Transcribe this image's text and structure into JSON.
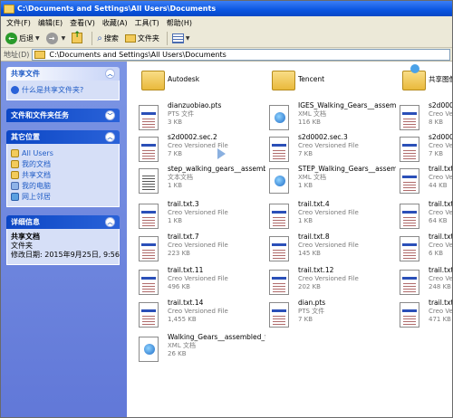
{
  "window": {
    "title": "C:\\Documents and Settings\\All Users\\Documents"
  },
  "menu": [
    "文件(F)",
    "编辑(E)",
    "查看(V)",
    "收藏(A)",
    "工具(T)",
    "帮助(H)"
  ],
  "toolbar": {
    "back_label": "后退",
    "search_label": "搜索",
    "folders_label": "文件夹"
  },
  "address": {
    "label": "地址(D)",
    "path": "C:\\Documents and Settings\\All Users\\Documents"
  },
  "tasks": {
    "shared_files": {
      "title": "共享文件",
      "items": [
        "什么是共享文件夹?"
      ]
    },
    "file_tasks": {
      "title": "文件和文件夹任务"
    },
    "other_places": {
      "title": "其它位置",
      "items": [
        "All Users",
        "我的文档",
        "共享文档",
        "我的电脑",
        "网上邻居"
      ]
    },
    "details": {
      "title": "详细信息",
      "name": "共享文档",
      "type": "文件夹",
      "modified": "修改日期: 2015年9月25日, 9:56"
    }
  },
  "files": [
    {
      "name": "Autodesk",
      "type": "",
      "size": "",
      "icon": "folder"
    },
    {
      "name": "Tencent",
      "type": "",
      "size": "",
      "icon": "folder"
    },
    {
      "name": "共享图像",
      "type": "",
      "size": "",
      "icon": "shared-folder"
    },
    {
      "name": "dianzuobiao.pts",
      "type": "PTS 文件",
      "size": "3 KB",
      "icon": "doc"
    },
    {
      "name": "IGES_Walking_Gears__assembled_...",
      "type": "XML 文档",
      "size": "116 KB",
      "icon": "xml"
    },
    {
      "name": "s2d0001.s",
      "type": "Creo Ve",
      "size": "8 KB",
      "icon": "doc"
    },
    {
      "name": "s2d0002.sec.2",
      "type": "Creo Versioned File",
      "size": "7 KB",
      "icon": "doc"
    },
    {
      "name": "s2d0002.sec.3",
      "type": "Creo Versioned File",
      "size": "7 KB",
      "icon": "doc"
    },
    {
      "name": "s2d0002.s",
      "type": "Creo Ve",
      "size": "7 KB",
      "icon": "doc"
    },
    {
      "name": "step_walking_gears__assembled_...",
      "type": "文本文档",
      "size": "1 KB",
      "icon": "txt"
    },
    {
      "name": "STEP_Walking_Gears__assembled_...",
      "type": "XML 文档",
      "size": "1 KB",
      "icon": "xml"
    },
    {
      "name": "trail.txt.1",
      "type": "Creo Ve",
      "size": "44 KB",
      "icon": "doc"
    },
    {
      "name": "trail.txt.3",
      "type": "Creo Versioned File",
      "size": "1 KB",
      "icon": "doc"
    },
    {
      "name": "trail.txt.4",
      "type": "Creo Versioned File",
      "size": "1 KB",
      "icon": "doc"
    },
    {
      "name": "trail.txt.5",
      "type": "Creo Ve",
      "size": "64 KB",
      "icon": "doc"
    },
    {
      "name": "trail.txt.7",
      "type": "Creo Versioned File",
      "size": "223 KB",
      "icon": "doc"
    },
    {
      "name": "trail.txt.8",
      "type": "Creo Versioned File",
      "size": "145 KB",
      "icon": "doc"
    },
    {
      "name": "trail.txt.9",
      "type": "Creo Ve",
      "size": "6 KB",
      "icon": "doc"
    },
    {
      "name": "trail.txt.11",
      "type": "Creo Versioned File",
      "size": "496 KB",
      "icon": "doc"
    },
    {
      "name": "trail.txt.12",
      "type": "Creo Versioned File",
      "size": "202 KB",
      "icon": "doc"
    },
    {
      "name": "trail.txt.1",
      "type": "Creo Ve",
      "size": "248 KB",
      "icon": "doc"
    },
    {
      "name": "trail.txt.14",
      "type": "Creo Versioned File",
      "size": "1,455 KB",
      "icon": "doc"
    },
    {
      "name": "dian.pts",
      "type": "PTS 文件",
      "size": "7 KB",
      "icon": "doc"
    },
    {
      "name": "trail.txt.1",
      "type": "Creo Ve",
      "size": "471 KB",
      "icon": "doc"
    },
    {
      "name": "Walking_Gears__assembled_f...",
      "type": "XML 文档",
      "size": "26 KB",
      "icon": "xml"
    }
  ],
  "colors": {
    "title_bar": "#0a55e0",
    "task_pane": "#6f87de",
    "task_link": "#215dc6",
    "chrome": "#ece9d8"
  }
}
